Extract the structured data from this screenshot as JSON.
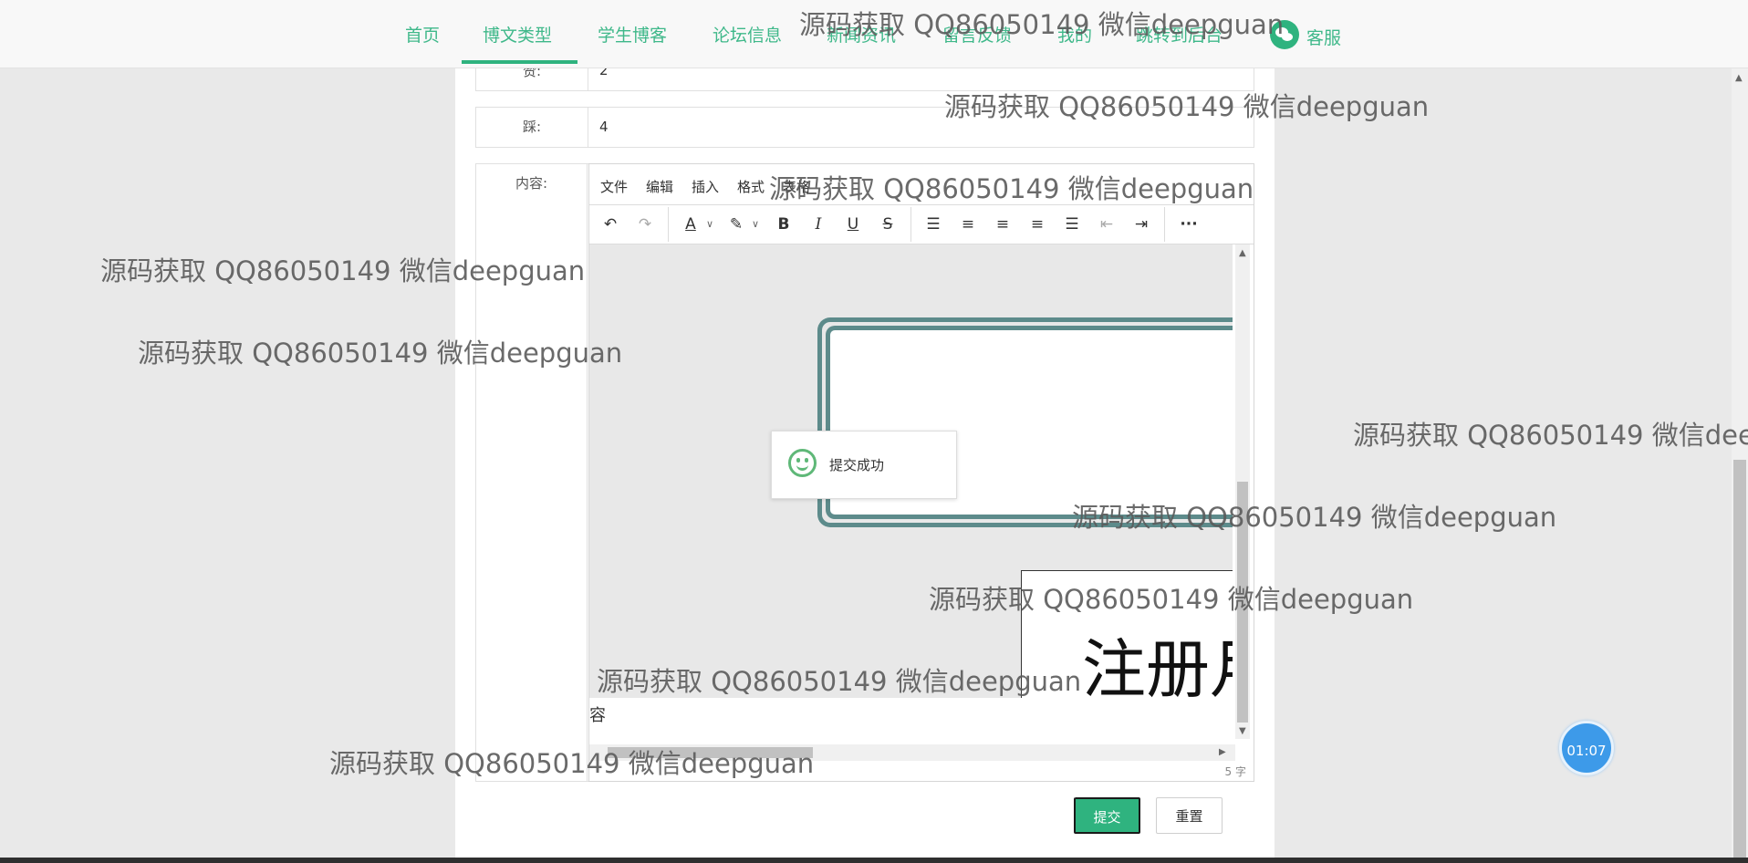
{
  "nav": {
    "items": [
      "首页",
      "博文类型",
      "学生博客",
      "论坛信息",
      "新闻资讯",
      "留言反馈",
      "我的",
      "跳转到后台"
    ],
    "active": "博文类型",
    "kefu": "客服",
    "accent": "#2fb37f"
  },
  "form": {
    "zan_label": "赞:",
    "zan_value": "2",
    "cai_label": "踩:",
    "cai_value": "4",
    "content_label": "内容:"
  },
  "editor": {
    "menus": [
      "文件",
      "编辑",
      "插入",
      "格式",
      "表格"
    ],
    "toolbar_icons": [
      "undo-icon",
      "redo-icon",
      "font-color-icon",
      "highlight-icon",
      "bold-icon",
      "italic-icon",
      "underline-icon",
      "strikethrough-icon",
      "line-height-icon",
      "align-left-icon",
      "align-center-icon",
      "align-right-icon",
      "align-justify-icon",
      "outdent-icon",
      "indent-icon",
      "more-icon"
    ],
    "image_text": "注册月",
    "content_text": "容",
    "word_count": "5 字"
  },
  "toast": {
    "message": "提交成功"
  },
  "buttons": {
    "submit": "提交",
    "reset": "重置"
  },
  "timer": "01:07",
  "watermark": "源码获取 QQ86050149 微信deepguan"
}
